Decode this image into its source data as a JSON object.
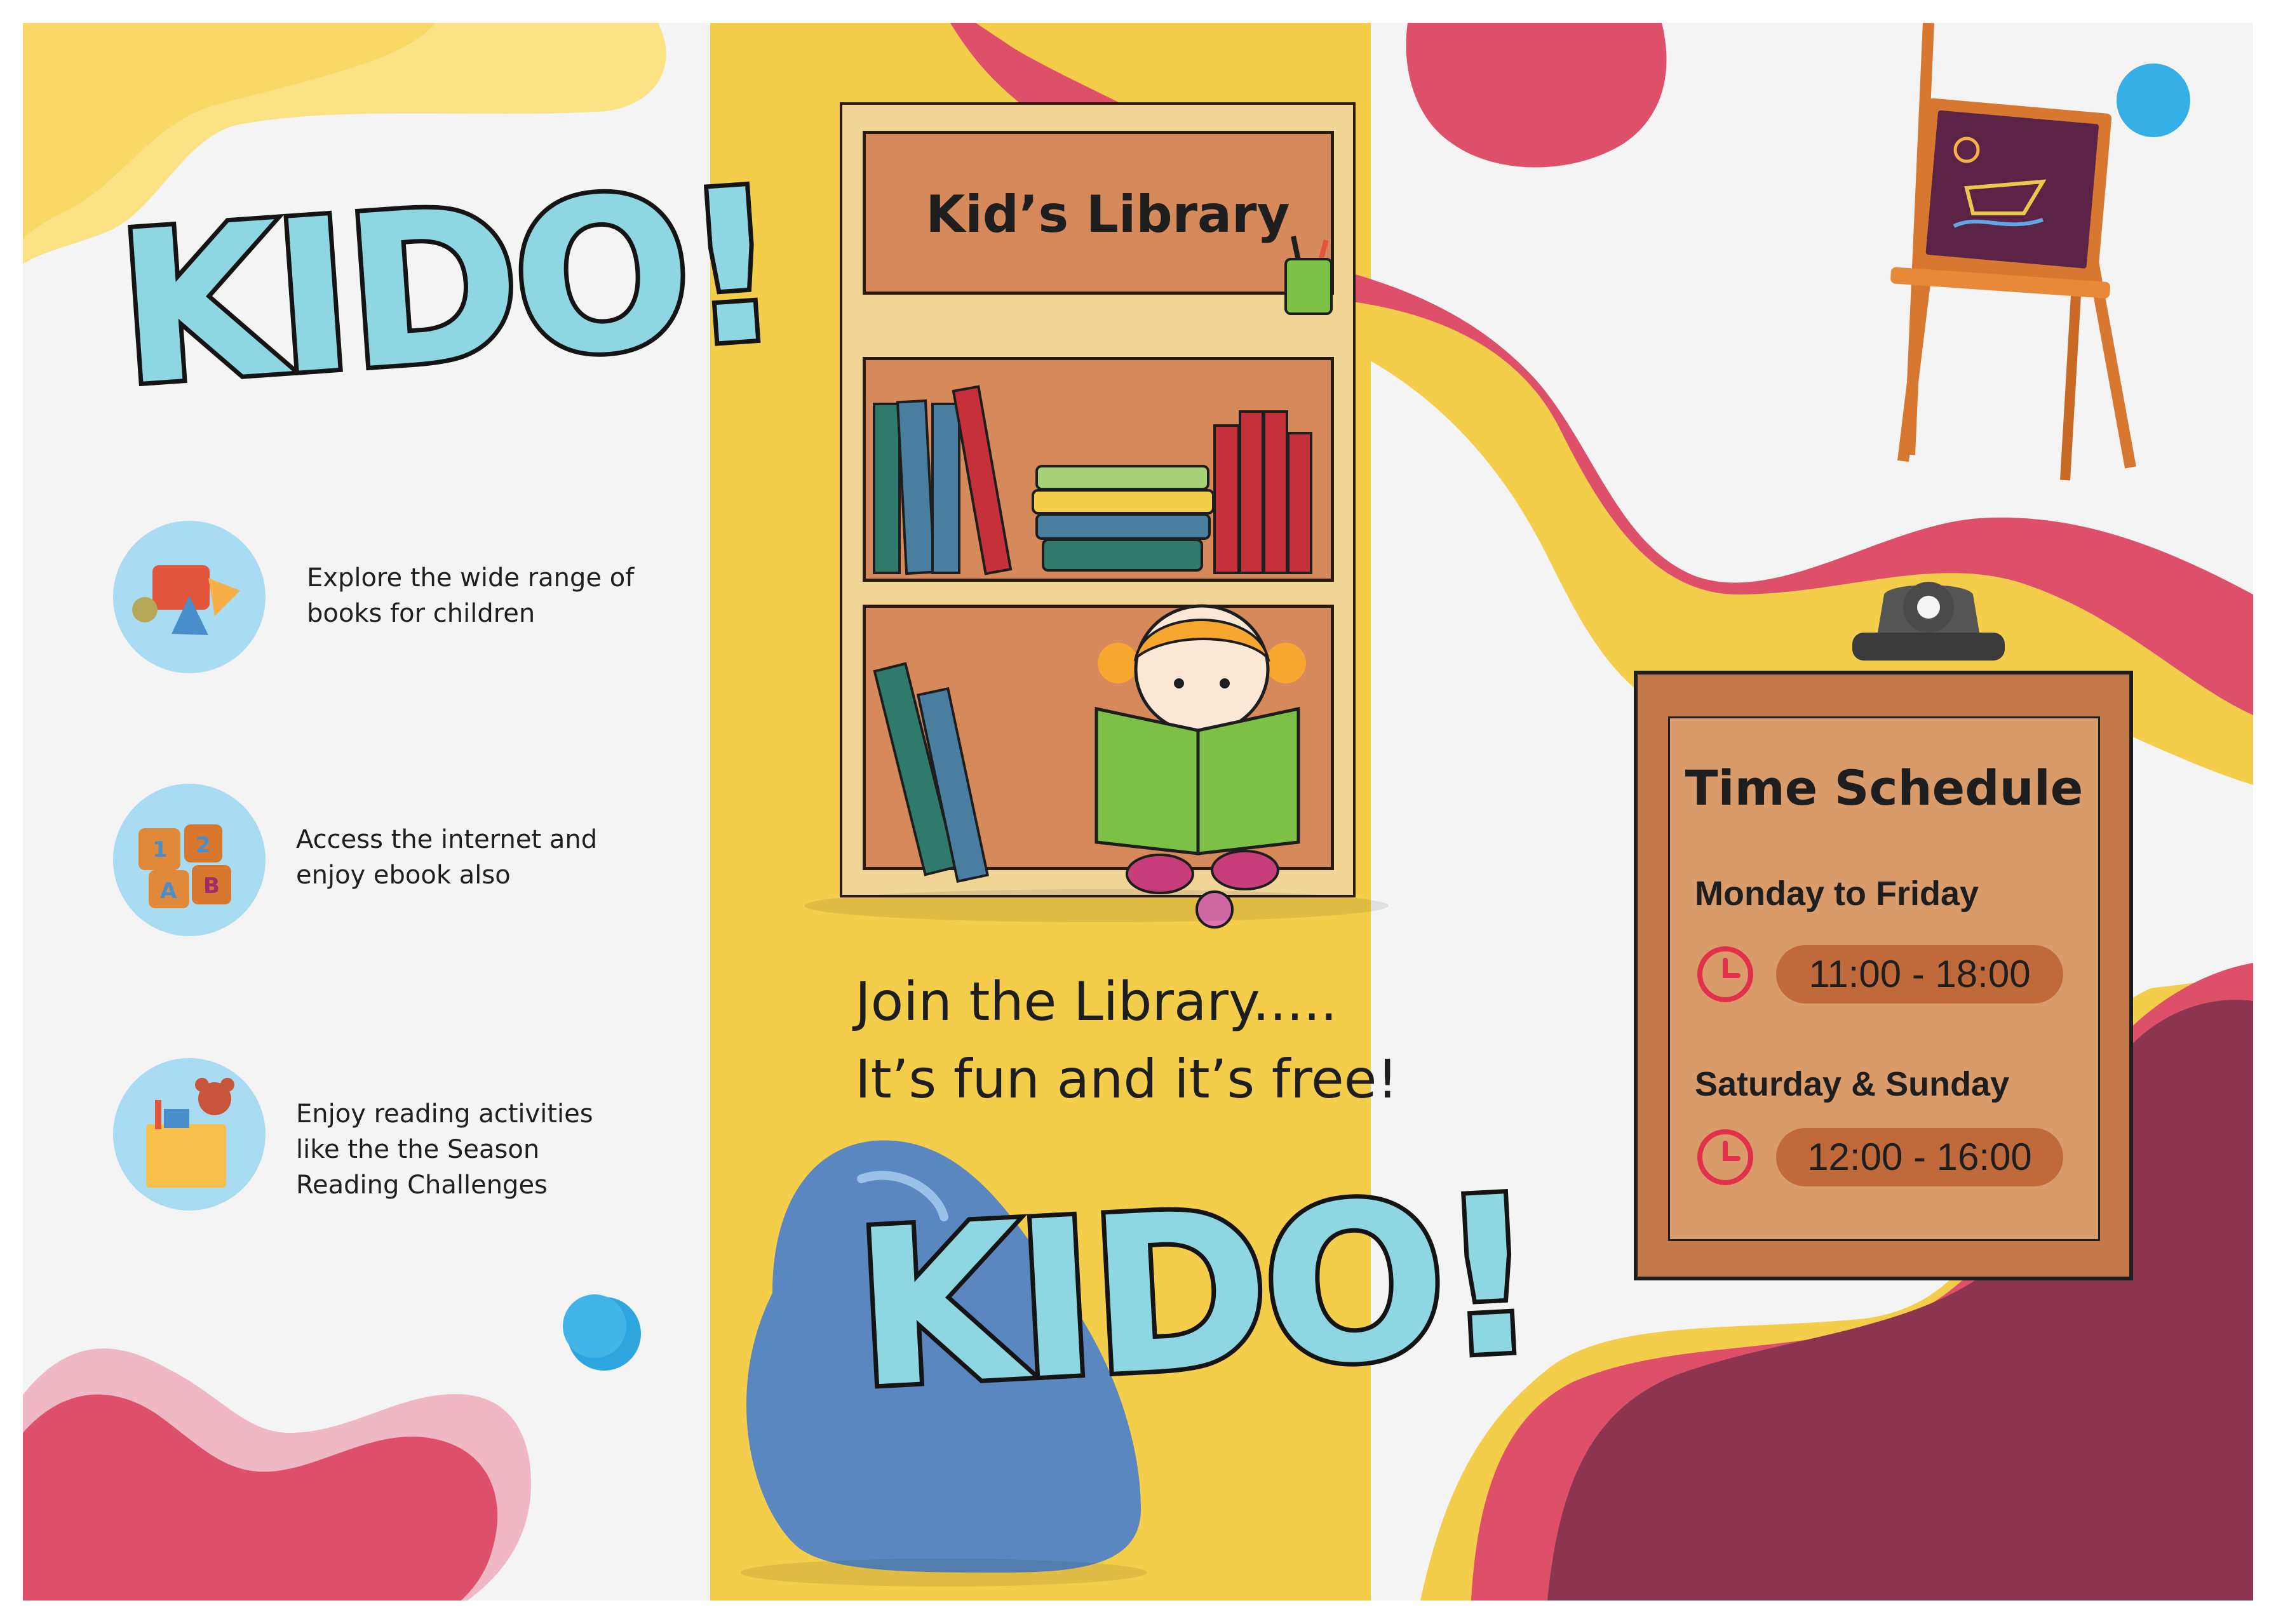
{
  "logo": {
    "text": "KIDO!"
  },
  "features": [
    {
      "text": "Explore the wide range of books for children",
      "icon": "shapes-icon"
    },
    {
      "text": "Access the internet and enjoy ebook also",
      "icon": "abc-blocks-icon"
    },
    {
      "text": "Enjoy reading activities like the the Season Reading Challenges",
      "icon": "toy-box-icon"
    }
  ],
  "library": {
    "title": "Kid’s Library"
  },
  "tagline": {
    "line1": "Join the Library.....",
    "line2": "It’s fun and it’s free!"
  },
  "schedule": {
    "title": "Time Schedule",
    "entries": [
      {
        "days": "Monday to Friday",
        "hours": "11:00 - 18:00"
      },
      {
        "days": "Saturday & Sunday",
        "hours": "12:00 - 16:00"
      }
    ]
  },
  "colors": {
    "yellow": "#f4cd4b",
    "pink": "#de506a",
    "maroon": "#8c3550",
    "blue": "#5b87c0",
    "sky": "#a9dcf2",
    "board": "#c4794a"
  }
}
